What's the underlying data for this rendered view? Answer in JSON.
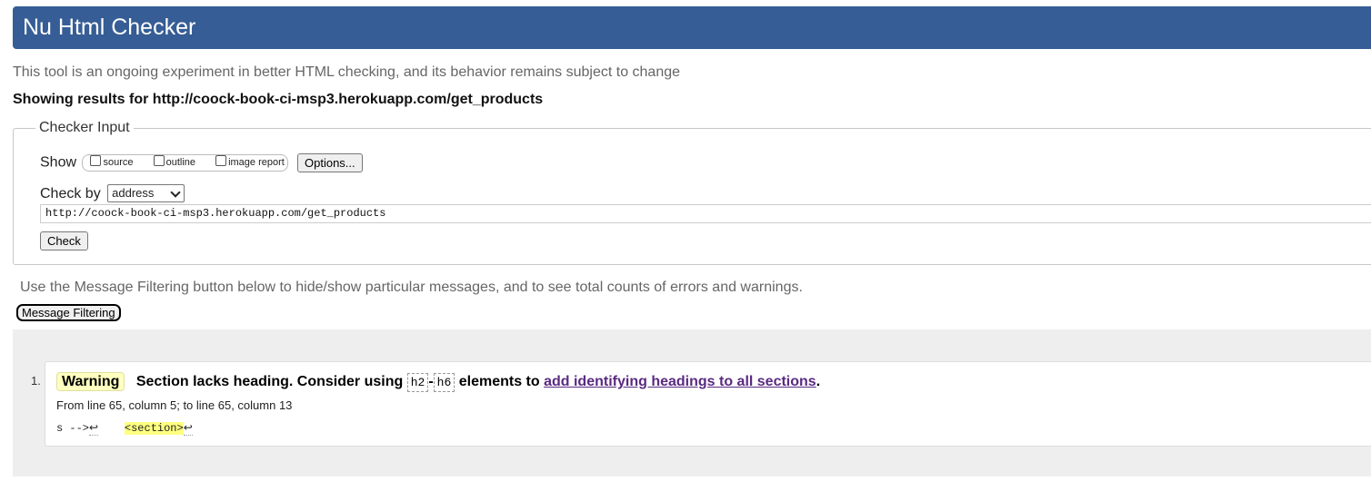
{
  "header": {
    "title": "Nu Html Checker"
  },
  "intro_text": "This tool is an ongoing experiment in better HTML checking, and its behavior remains subject to change",
  "results_heading": "Showing results for http://coock-book-ci-msp3.herokuapp.com/get_products",
  "checker_input": {
    "legend": "Checker Input",
    "show_label": "Show",
    "show_options": [
      {
        "label": "source",
        "checked": false
      },
      {
        "label": "outline",
        "checked": false
      },
      {
        "label": "image report",
        "checked": false
      }
    ],
    "options_button": "Options...",
    "check_by_label": "Check by",
    "check_by_value": "address",
    "url_value": "http://coock-book-ci-msp3.herokuapp.com/get_products",
    "check_button": "Check"
  },
  "filter_note": "Use the Message Filtering button below to hide/show particular messages, and to see total counts of errors and warnings.",
  "filter_button": "Message Filtering",
  "messages": [
    {
      "number": "1.",
      "type": "Warning",
      "text_before": "Section lacks heading. Consider using",
      "tag_start": "h2",
      "dash": "-",
      "tag_end": "h6",
      "text_middle": "elements to",
      "link_text": "add identifying headings to all sections",
      "text_after": ".",
      "location": "From line 65, column 5; to line 65, column 13",
      "extract_before": "s -->",
      "extract_line_break": "↩",
      "extract_spacing": "    ",
      "extract_marked": "<section>",
      "extract_end_break": "↩"
    }
  ]
}
